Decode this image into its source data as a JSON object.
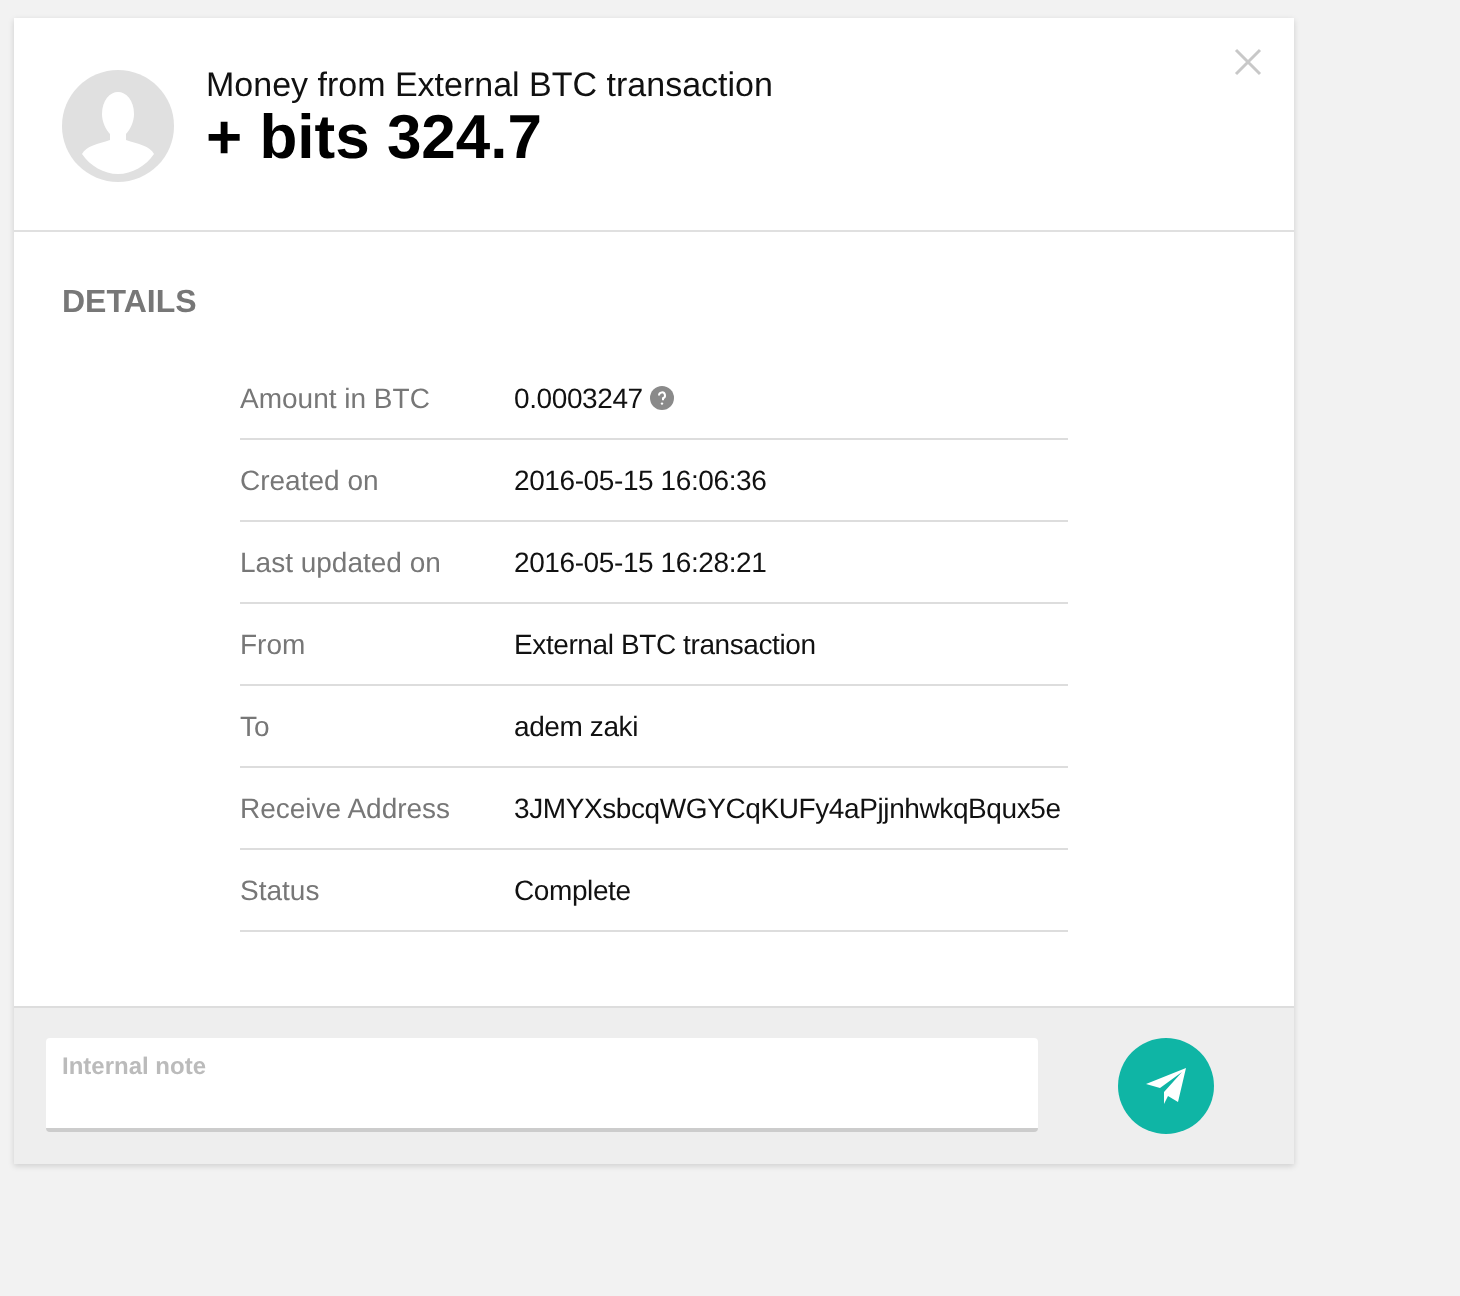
{
  "header": {
    "subtitle": "Money from External BTC transaction",
    "amount": "+ bits 324.7"
  },
  "details": {
    "heading": "DETAILS",
    "rows": [
      {
        "label": "Amount in BTC",
        "value": "0.0003247",
        "info": true
      },
      {
        "label": "Created on",
        "value": "2016-05-15 16:06:36",
        "info": false
      },
      {
        "label": "Last updated on",
        "value": "2016-05-15 16:28:21",
        "info": false
      },
      {
        "label": "From",
        "value": "External BTC transaction",
        "info": false
      },
      {
        "label": "To",
        "value": "adem zaki",
        "info": false
      },
      {
        "label": "Receive Address",
        "value": "3JMYXsbcqWGYCqKUFy4aPjjnhwkqBqux5e",
        "info": false
      },
      {
        "label": "Status",
        "value": "Complete",
        "info": false
      }
    ]
  },
  "footer": {
    "note": {
      "placeholder": "Internal note"
    }
  }
}
